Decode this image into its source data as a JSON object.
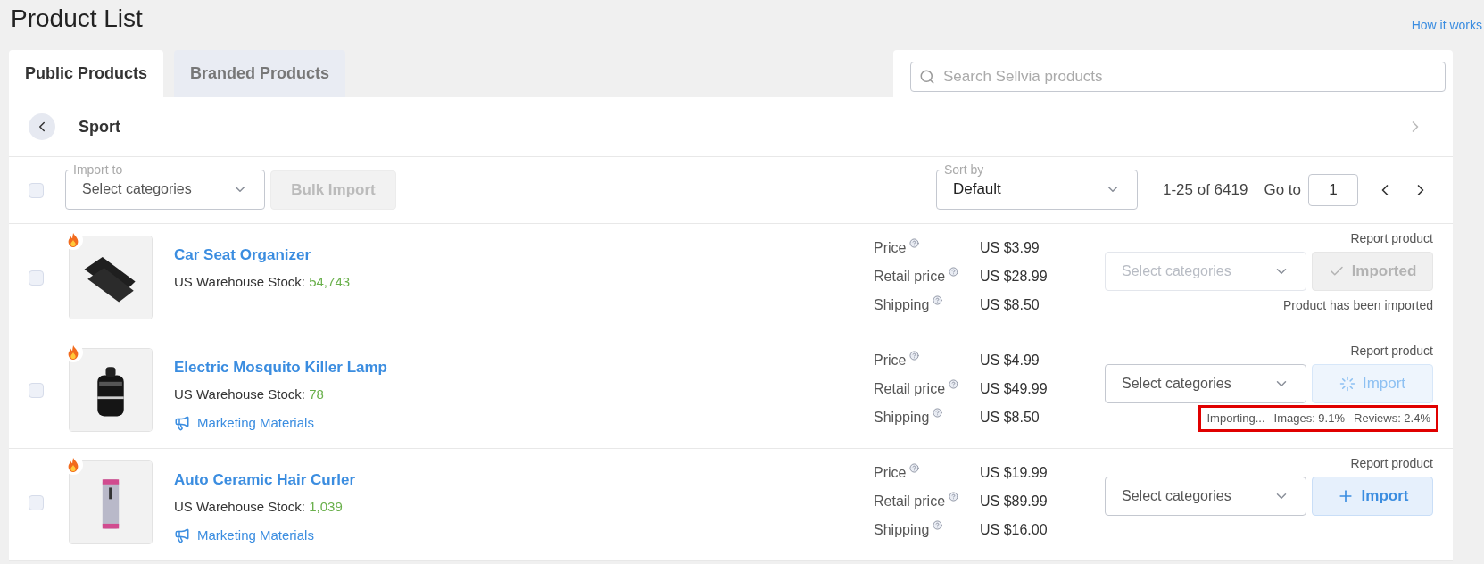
{
  "page_title": "Product List",
  "help_link": "How it works",
  "tabs": [
    {
      "label": "Public Products",
      "selected": true
    },
    {
      "label": "Branded Products",
      "selected": false
    }
  ],
  "search": {
    "placeholder": "Search Sellvia products"
  },
  "category": {
    "title": "Sport"
  },
  "toolbar": {
    "select_all": {
      "checked": false
    },
    "import_to": {
      "label": "Import to",
      "placeholder": "Select categories"
    },
    "bulk_import": {
      "label": "Bulk Import",
      "disabled": true
    },
    "sort": {
      "label": "Sort by",
      "value": "Default"
    },
    "range": "1-25 of 6419",
    "goto": {
      "label": "Go to",
      "value": "1"
    }
  },
  "products": [
    {
      "name": "Car Seat Organizer",
      "hot": true,
      "checked": false,
      "stock_label": "US Warehouse Stock:",
      "stock": "54,743",
      "prices": [
        {
          "label": "Price",
          "value": "US $3.99"
        },
        {
          "label": "Retail price",
          "value": "US $28.99"
        },
        {
          "label": "Shipping",
          "value": "US $8.50"
        }
      ],
      "report": "Report product",
      "category_placeholder": "Select categories",
      "category_disabled": true,
      "action": {
        "kind": "imported",
        "label": "Imported"
      },
      "note": "Product has been imported"
    },
    {
      "name": "Electric Mosquito Killer Lamp",
      "hot": true,
      "checked": false,
      "stock_label": "US Warehouse Stock:",
      "stock": "78",
      "marketing": "Marketing Materials",
      "prices": [
        {
          "label": "Price",
          "value": "US $4.99"
        },
        {
          "label": "Retail price",
          "value": "US $49.99"
        },
        {
          "label": "Shipping",
          "value": "US $8.50"
        }
      ],
      "report": "Report product",
      "category_placeholder": "Select categories",
      "category_disabled": false,
      "action": {
        "kind": "importing",
        "label": "Import"
      },
      "progress": [
        "Importing...",
        "Images: 9.1%",
        "Reviews: 2.4%"
      ],
      "highlighted": true
    },
    {
      "name": "Auto Ceramic Hair Curler",
      "hot": true,
      "checked": false,
      "stock_label": "US Warehouse Stock:",
      "stock": "1,039",
      "marketing": "Marketing Materials",
      "prices": [
        {
          "label": "Price",
          "value": "US $19.99"
        },
        {
          "label": "Retail price",
          "value": "US $89.99"
        },
        {
          "label": "Shipping",
          "value": "US $16.00"
        }
      ],
      "report": "Report product",
      "category_placeholder": "Select categories",
      "category_disabled": false,
      "action": {
        "kind": "import",
        "label": "Import"
      }
    }
  ]
}
